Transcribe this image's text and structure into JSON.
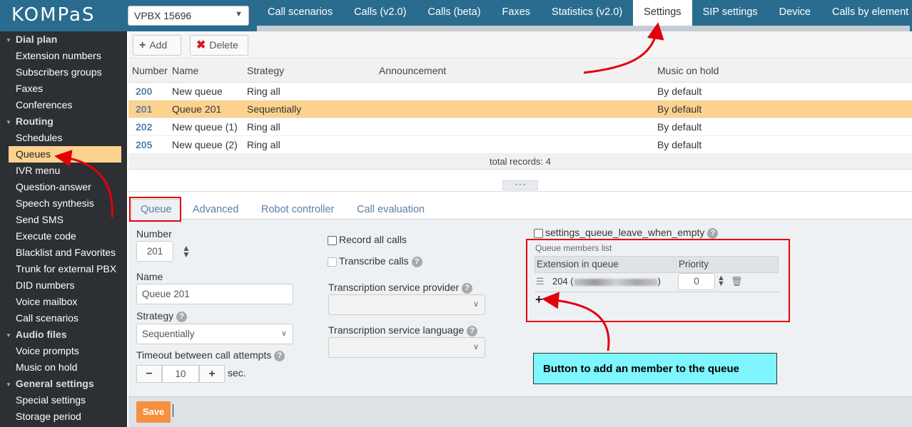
{
  "app": {
    "logo": "KOMPaS",
    "vpbx_selector": "VPBX 15696"
  },
  "top_tabs": [
    "Call scenarios",
    "Calls (v2.0)",
    "Calls (beta)",
    "Faxes",
    "Statistics (v2.0)",
    "Settings",
    "SIP settings",
    "Device",
    "Calls by element"
  ],
  "top_tabs_active": "Settings",
  "sidebar": {
    "groups": [
      {
        "label": "Dial plan",
        "items": [
          "Extension numbers",
          "Subscribers groups",
          "Faxes",
          "Conferences"
        ]
      },
      {
        "label": "Routing",
        "items": [
          "Schedules",
          "Queues",
          "IVR menu",
          "Question-answer",
          "Speech synthesis",
          "Send SMS",
          "Execute code",
          "Blacklist and Favorites",
          "Trunk for external PBX",
          "DID numbers",
          "Voice mailbox",
          "Call scenarios"
        ]
      },
      {
        "label": "Audio files",
        "items": [
          "Voice prompts",
          "Music on hold"
        ]
      },
      {
        "label": "General settings",
        "items": [
          "Special settings",
          "Storage period"
        ]
      }
    ],
    "active_item": "Queues"
  },
  "toolbar": {
    "add_label": "Add",
    "delete_label": "Delete"
  },
  "table": {
    "columns": [
      "Number",
      "Name",
      "Strategy",
      "Announcement",
      "Music on hold"
    ],
    "rows": [
      {
        "number": "200",
        "name": "New queue",
        "strategy": "Ring all",
        "announcement": "",
        "moh": "By default"
      },
      {
        "number": "201",
        "name": "Queue 201",
        "strategy": "Sequentially",
        "announcement": "",
        "moh": "By default",
        "selected": true
      },
      {
        "number": "202",
        "name": "New queue (1)",
        "strategy": "Ring all",
        "announcement": "",
        "moh": "By default"
      },
      {
        "number": "205",
        "name": "New queue (2)",
        "strategy": "Ring all",
        "announcement": "",
        "moh": "By default"
      }
    ],
    "total": "total records: 4"
  },
  "sub_tabs": [
    "Queue",
    "Advanced",
    "Robot controller",
    "Call evaluation"
  ],
  "form": {
    "number_label": "Number",
    "number_value": "201",
    "name_label": "Name",
    "name_value": "Queue 201",
    "strategy_label": "Strategy",
    "strategy_value": "Sequentially",
    "timeout_label": "Timeout between call attempts",
    "timeout_value": "10",
    "timeout_unit": "sec.",
    "record_label": "Record all calls",
    "transcribe_label": "Transcribe calls",
    "provider_label": "Transcription service provider",
    "language_label": "Transcription service language",
    "leave_empty_label": "settings_queue_leave_when_empty",
    "members_title": "Queue members list",
    "members_col_ext": "Extension in queue",
    "members_col_prio": "Priority",
    "member_ext": "204 (",
    "member_ext_close": ")",
    "member_priority": "0",
    "save_label": "Save"
  },
  "callout": "Button to add an member to the queue",
  "colors": {
    "topbar": "#2a6c8f",
    "sidebar": "#2c2f33",
    "selected": "#fdd28f",
    "highlight_border": "#e3000b",
    "callout_bg": "#7ff6ff",
    "save": "#f5913e"
  }
}
